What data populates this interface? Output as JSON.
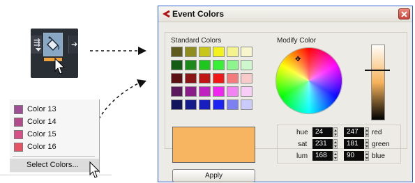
{
  "toolbar": {
    "icons": [
      "dart-icon",
      "color-tool-icon",
      "arrow-right-icon",
      "cursor-arrow-icon"
    ],
    "active_color": "#f0a33a"
  },
  "menu": {
    "items": [
      {
        "label": "Color 13",
        "color": "#9e4f96"
      },
      {
        "label": "Color 14",
        "color": "#b34b8b"
      },
      {
        "label": "Color 15",
        "color": "#d64f86"
      },
      {
        "label": "Color 16",
        "color": "#e55364"
      }
    ],
    "select_label": "Select Colors..."
  },
  "dialog": {
    "title": "Event Colors",
    "standard_label": "Standard Colors",
    "modify_label": "Modify Color",
    "swatches": [
      [
        "#5f5a1e",
        "#8f8d1e",
        "#c8c61a",
        "#f4f21c",
        "#f5f38e",
        "#f7f6cc"
      ],
      [
        "#145b14",
        "#1b8a1b",
        "#1ec61e",
        "#39f039",
        "#8cf58c",
        "#cdf8cd"
      ],
      [
        "#5b1111",
        "#8b1414",
        "#bf1515",
        "#f01717",
        "#f37b7b",
        "#f8caca"
      ],
      [
        "#5b1a5b",
        "#8b1d8b",
        "#bf22bf",
        "#f025f0",
        "#f383f3",
        "#f8cdf8"
      ],
      [
        "#11145b",
        "#151a8b",
        "#181dbf",
        "#1c22f0",
        "#7d80f3",
        "#cacbf8"
      ]
    ],
    "selected_color": "#f7b561",
    "values": {
      "hue": {
        "label": "hue",
        "value": "24"
      },
      "sat": {
        "label": "sat",
        "value": "231"
      },
      "lum": {
        "label": "lum",
        "value": "168"
      },
      "red": {
        "label": "red",
        "value": "247"
      },
      "green": {
        "label": "green",
        "value": "181"
      },
      "blue": {
        "label": "blue",
        "value": "90"
      }
    },
    "apply_label": "Apply"
  }
}
